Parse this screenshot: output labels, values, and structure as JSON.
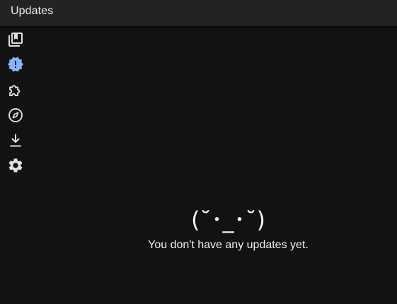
{
  "header": {
    "title": "Updates"
  },
  "sidebar": {
    "items": [
      {
        "name": "library",
        "icon": "library-icon",
        "active": false
      },
      {
        "name": "updates",
        "icon": "updates-alert-icon",
        "active": true
      },
      {
        "name": "extensions",
        "icon": "puzzle-icon",
        "active": false
      },
      {
        "name": "browse",
        "icon": "compass-icon",
        "active": false
      },
      {
        "name": "downloads",
        "icon": "download-icon",
        "active": false
      },
      {
        "name": "settings",
        "icon": "gear-icon",
        "active": false
      }
    ]
  },
  "empty_state": {
    "kaomoji": "(˘･_･˘)",
    "message": "You don't have any updates yet."
  },
  "colors": {
    "background": "#121212",
    "header": "#232323",
    "icon": "#e0e0e0",
    "accent": "#8ab4f8"
  }
}
